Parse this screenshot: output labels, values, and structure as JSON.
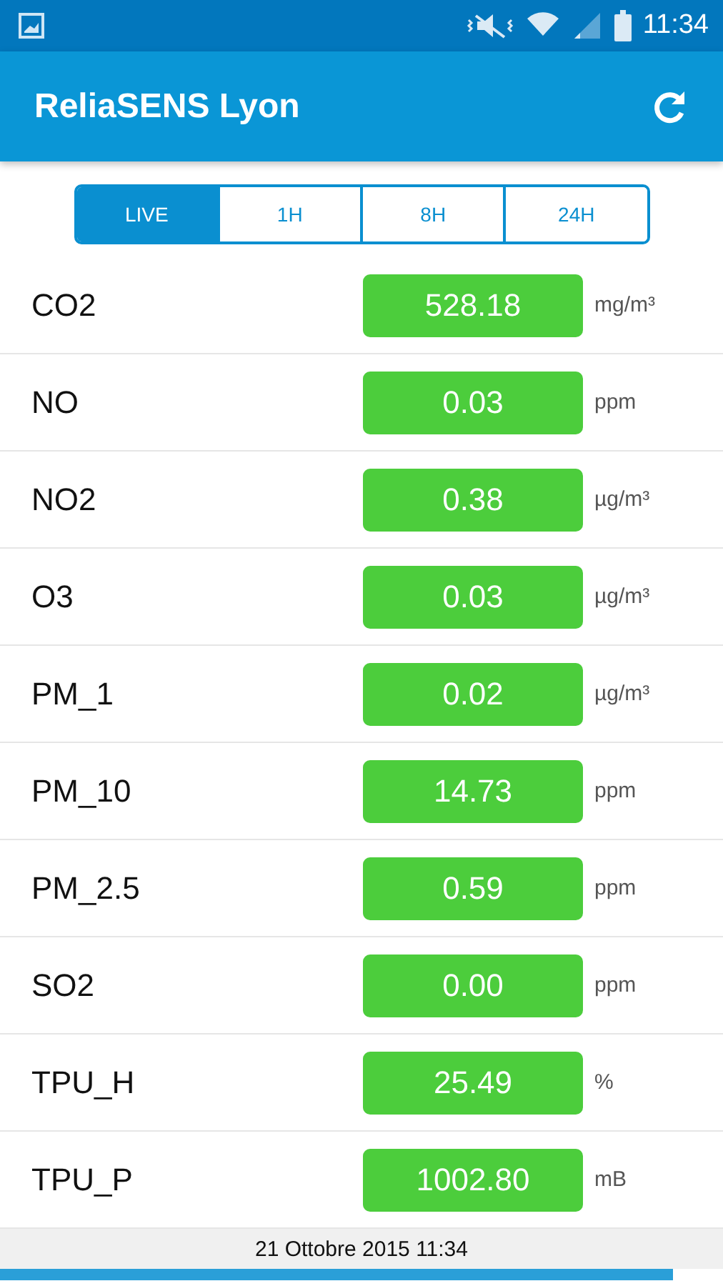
{
  "status_bar": {
    "time": "11:34"
  },
  "app_bar": {
    "title": "ReliaSENS Lyon"
  },
  "tabs": [
    {
      "label": "LIVE",
      "selected": true
    },
    {
      "label": "1H",
      "selected": false
    },
    {
      "label": "8H",
      "selected": false
    },
    {
      "label": "24H",
      "selected": false
    }
  ],
  "readings": [
    {
      "name": "CO2",
      "value": "528.18",
      "unit": "mg/m³"
    },
    {
      "name": "NO",
      "value": "0.03",
      "unit": "ppm"
    },
    {
      "name": "NO2",
      "value": "0.38",
      "unit": "µg/m³"
    },
    {
      "name": "O3",
      "value": "0.03",
      "unit": "µg/m³"
    },
    {
      "name": "PM_1",
      "value": "0.02",
      "unit": "µg/m³"
    },
    {
      "name": "PM_10",
      "value": "14.73",
      "unit": "ppm"
    },
    {
      "name": "PM_2.5",
      "value": "0.59",
      "unit": "ppm"
    },
    {
      "name": "SO2",
      "value": "0.00",
      "unit": "ppm"
    },
    {
      "name": "TPU_H",
      "value": "25.49",
      "unit": "%"
    },
    {
      "name": "TPU_P",
      "value": "1002.80",
      "unit": "mB"
    }
  ],
  "footer": {
    "timestamp": "21 Ottobre 2015 11:34"
  }
}
